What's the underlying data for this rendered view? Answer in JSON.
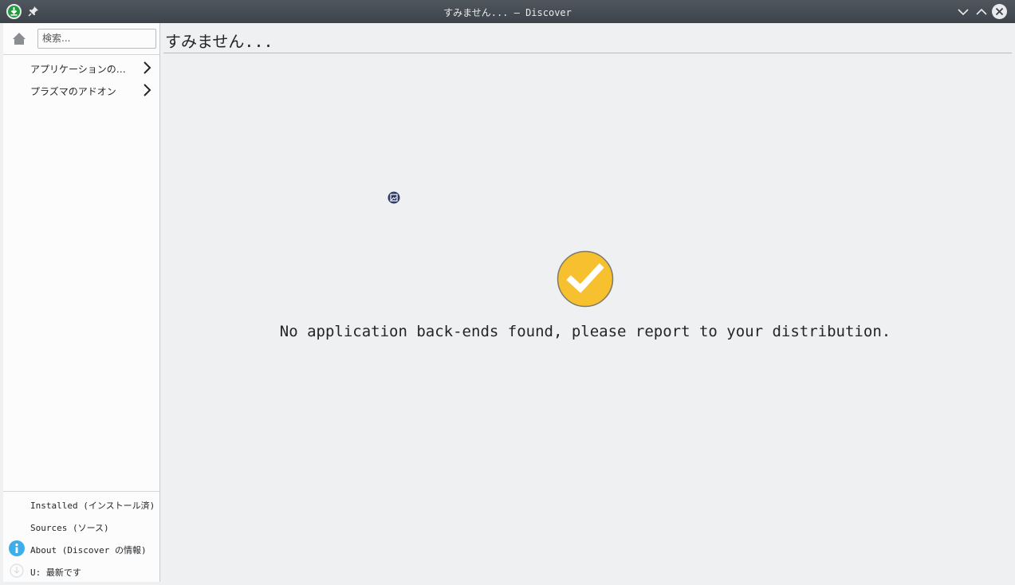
{
  "window": {
    "title": "すみません... — Discover"
  },
  "sidebar": {
    "search_placeholder": "検索...",
    "categories": [
      {
        "label": "アプリケーションの…"
      },
      {
        "label": "プラズマのアドオン"
      }
    ],
    "footer": [
      {
        "label": "Installed (インストール済)",
        "icon": ""
      },
      {
        "label": "Sources (ソース)",
        "icon": ""
      },
      {
        "label": "About (Discover の情報)",
        "icon": "info-icon"
      },
      {
        "label": "U: 最新です",
        "icon": "update-icon"
      }
    ]
  },
  "main": {
    "page_title": "すみません...",
    "message": "No application back-ends found, please report to your distribution."
  },
  "colors": {
    "titlebar": "#474d54",
    "check_badge": "#f6c02e",
    "info_icon": "#3daee9"
  }
}
